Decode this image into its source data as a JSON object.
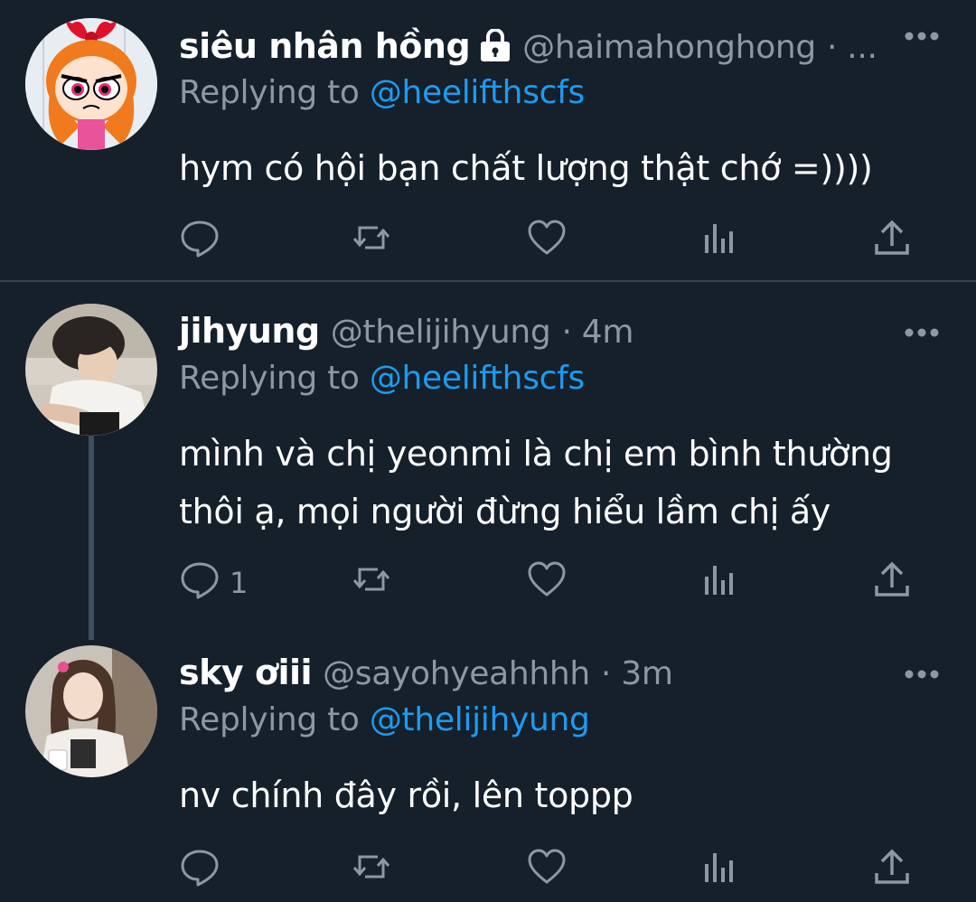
{
  "tweets": [
    {
      "name": "siêu nhân hồng",
      "handle": "@haimahonghong",
      "time": "· ...",
      "replying_prefix": "Replying to ",
      "replying_to": "@heelifthscfs",
      "text": "hym có hội bạn chất lượng thật chớ =))))",
      "reply_count": ""
    },
    {
      "name": "jihyung",
      "handle": "@thelijihyung",
      "time": "· 4m",
      "replying_prefix": "Replying to ",
      "replying_to": "@heelifthscfs",
      "text": "mình và chị yeonmi là chị em bình thường\nthôi ạ, mọi người đừng hiểu lầm chị ấy",
      "reply_count": "1"
    },
    {
      "name": "sky ơiii",
      "handle": "@sayohyeahhhh",
      "time": "· 3m",
      "replying_prefix": "Replying to ",
      "replying_to": "@thelijihyung",
      "text": "nv chính đây rồi, lên toppp",
      "reply_count": ""
    }
  ],
  "colors": {
    "background": "#15202b",
    "text_primary": "#ffffff",
    "text_secondary": "#8b98a5",
    "link": "#1d9bf0",
    "divider": "#38444d"
  },
  "icons": [
    "reply-icon",
    "retweet-icon",
    "like-icon",
    "views-icon",
    "share-icon",
    "more-icon",
    "lock-icon"
  ]
}
